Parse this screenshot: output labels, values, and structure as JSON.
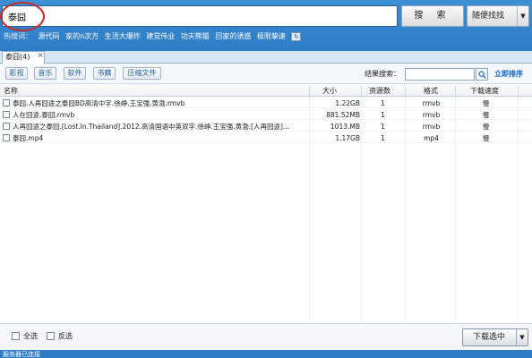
{
  "search": {
    "query": "泰囧",
    "search_button": "搜 索",
    "random_button": "随便找找",
    "random_arrow": "▼"
  },
  "hot": {
    "label": "热搜词：",
    "words": [
      "源代码",
      "家的n次方",
      "生活大爆炸",
      "建党伟业",
      "功夫熊猫",
      "回家的诱惑",
      "极限挚速"
    ]
  },
  "tab": {
    "label": "泰囧(4)",
    "close": "×"
  },
  "filters": [
    "影视",
    "音乐",
    "软件",
    "书籍",
    "压缩文件"
  ],
  "result_filter": {
    "label": "结果搜索：",
    "sort_link": "立即排序"
  },
  "table": {
    "columns": [
      "名称",
      "大小",
      "资源数",
      "格式",
      "下载速度"
    ],
    "rows": [
      {
        "name": "泰囧.人再囧途之泰囧BD高清中字.徐峥.王宝强.黄渤.rmvb",
        "size": "1.22GB",
        "resources": "1",
        "format": "rmvb",
        "speed": "慢"
      },
      {
        "name": "人在囧途.泰囧.rmvb",
        "size": "881.52MB",
        "resources": "1",
        "format": "rmvb",
        "speed": "慢"
      },
      {
        "name": "人再囧途之泰囧.[Lost.In.Thailand].2012.高清国语中英双字.徐峥.王宝强.黄渤.[人再囧途]...",
        "size": "1013.MB",
        "resources": "1",
        "format": "rmvb",
        "speed": "慢"
      },
      {
        "name": "泰囧.mp4",
        "size": "1.17GB",
        "resources": "1",
        "format": "mp4",
        "speed": "慢"
      }
    ]
  },
  "bottom": {
    "select_all": "全选",
    "invert": "反选",
    "download_button": "下载选中",
    "download_arrow": "▼"
  },
  "status": {
    "text": "服务器已连接"
  },
  "colors": {
    "topbar": "#3d8fd4",
    "highlight_circle": "#c82b2b",
    "sort_link": "#1565c0"
  }
}
